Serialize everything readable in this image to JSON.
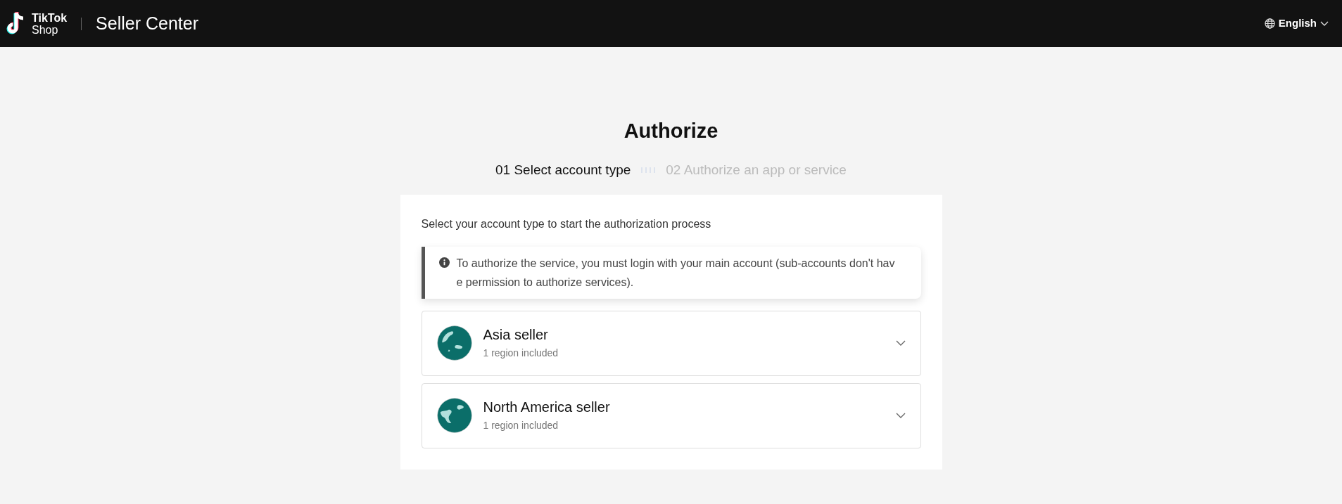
{
  "header": {
    "logo_top": "TikTok",
    "logo_bottom": "Shop",
    "title": "Seller Center",
    "language": "English"
  },
  "page": {
    "title": "Authorize",
    "steps": [
      {
        "label": "01 Select account type",
        "active": true
      },
      {
        "label": "02 Authorize an app or service",
        "active": false
      }
    ],
    "instruction": "Select your account type to start the authorization process",
    "notice": "To authorize the service, you must login with your main account (sub-accounts don't have permission to authorize services).",
    "account_types": [
      {
        "kind": "asia",
        "title": "Asia seller",
        "subtitle": "1 region included",
        "expanded": false
      },
      {
        "kind": "north-america",
        "title": "North America seller",
        "subtitle": "1 region included",
        "expanded": false
      }
    ]
  }
}
